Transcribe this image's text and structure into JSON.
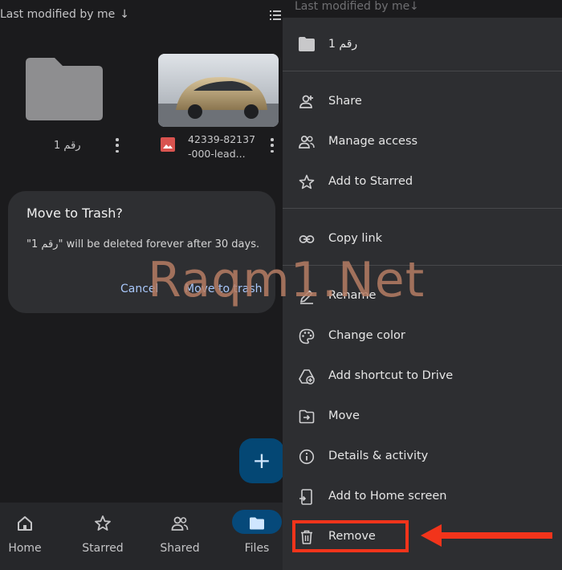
{
  "sort_bar": {
    "label": "Last modified by me",
    "arrow": "↓"
  },
  "files": [
    {
      "name": "رقم 1",
      "type": "folder"
    },
    {
      "name_line1": "42339-82137",
      "name_line2": "-000-lead...",
      "type": "image"
    }
  ],
  "dialog": {
    "title": "Move to Trash?",
    "message": "\"رقم 1\" will be deleted forever after 30 days.",
    "cancel_label": "Cancel",
    "confirm_label": "Move to trash"
  },
  "fab": {
    "icon": "+"
  },
  "bottom_nav": [
    {
      "label": "Home",
      "icon": "home-icon"
    },
    {
      "label": "Starred",
      "icon": "star-icon"
    },
    {
      "label": "Shared",
      "icon": "people-icon"
    },
    {
      "label": "Files",
      "icon": "folder-icon",
      "active": true
    }
  ],
  "menu": {
    "top_label": "Last modified by me",
    "header": {
      "label": "رقم 1",
      "icon": "folder-icon"
    },
    "items": [
      {
        "label": "Share",
        "icon": "person-add-icon"
      },
      {
        "label": "Manage access",
        "icon": "people-icon"
      },
      {
        "label": "Add to Starred",
        "icon": "star-outline-icon"
      },
      {
        "label": "Copy link",
        "icon": "link-icon"
      },
      {
        "label": "Rename",
        "icon": "pencil-icon"
      },
      {
        "label": "Change color",
        "icon": "palette-icon"
      },
      {
        "label": "Add shortcut to Drive",
        "icon": "shortcut-icon"
      },
      {
        "label": "Move",
        "icon": "move-icon"
      },
      {
        "label": "Details & activity",
        "icon": "info-icon"
      },
      {
        "label": "Add to Home screen",
        "icon": "add-home-icon"
      },
      {
        "label": "Remove",
        "icon": "trash-icon"
      }
    ]
  },
  "watermark": "Raqm1.Net",
  "colors": {
    "background": "#1b1b1d",
    "menu_background": "#2d2e31",
    "dialog_background": "#2e2f32",
    "accent_blue": "#a8c7fa",
    "fab": "#044774",
    "highlight_red": "#f2341b"
  }
}
